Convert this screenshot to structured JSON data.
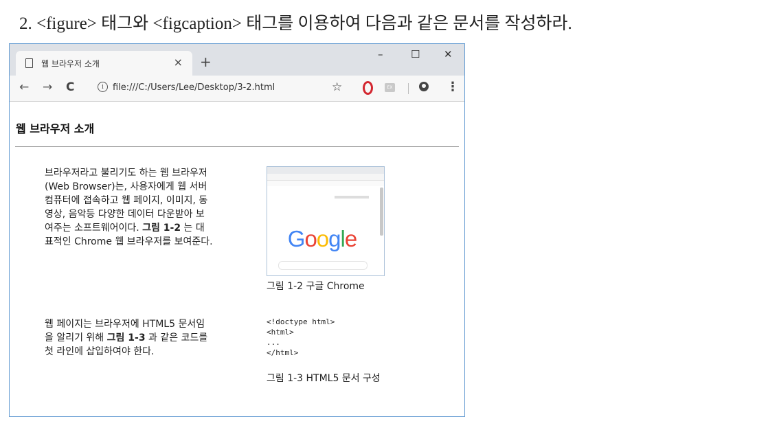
{
  "question": "2. <figure> 태그와 <figcaption> 태그를 이용하여 다음과 같은 문서를 작성하라.",
  "browser": {
    "tab_title": "웹 브라우저 소개",
    "tab_close": "×",
    "new_tab": "+",
    "window_controls": {
      "minimize": "–",
      "maximize": "☐",
      "close": "✕"
    },
    "nav": {
      "back": "←",
      "forward": "→",
      "reload": "C"
    },
    "url": "file:///C:/Users/Lee/Desktop/3-2.html",
    "info_icon": "i",
    "star": "☆",
    "ext_icon_text": "EX",
    "menu": "⋮"
  },
  "page": {
    "heading": "웹 브라우저 소개",
    "para1_text": "브라우저라고 불리기도 하는 웹 브라우저(Web Browser)는, 사용자에게 웹 서버 컴퓨터에 접속하고 웹 페이지, 이미지, 동영상, 음악등 다양한 데이터 다운받아 보여주는 소프트웨어이다. ",
    "para1_ref": "그림 1-2",
    "para1_tail": " 는 대표적인 Chrome 웹 브라우저를 보여준다.",
    "para2_text": "웹 페이지는 브라우저에 HTML5 문서임을 알리기 위해 ",
    "para2_ref": "그림 1-3",
    "para2_tail": " 과 같은 코드를 첫 라인에 삽입하여야 한다.",
    "figure1": {
      "google_letters": [
        "G",
        "o",
        "o",
        "g",
        "l",
        "e"
      ],
      "google_colors": [
        "#4285F4",
        "#EA4335",
        "#FBBC05",
        "#4285F4",
        "#34A853",
        "#EA4335"
      ],
      "caption": "그림 1-2 구글 Chrome"
    },
    "figure2": {
      "code": "<!doctype html>\n<html>\n...\n</html>",
      "caption": "그림 1-3 HTML5 문서 구성"
    }
  }
}
